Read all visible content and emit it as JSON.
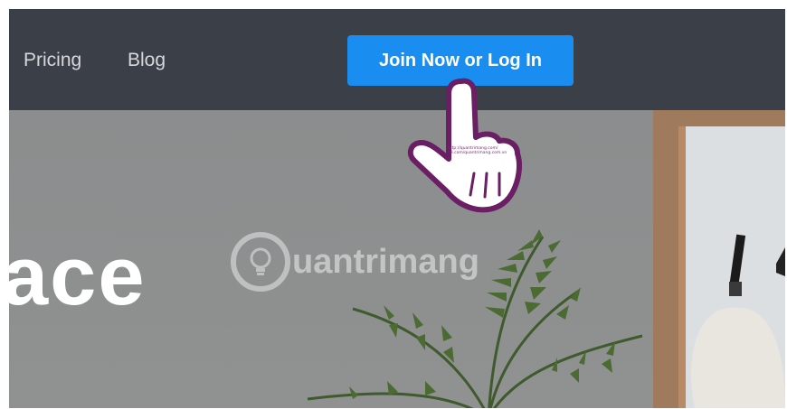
{
  "nav": {
    "links": [
      {
        "label": "Pricing"
      },
      {
        "label": "Blog"
      }
    ],
    "cta_label": "Join Now or Log In"
  },
  "hero": {
    "headline_fragment": "ace"
  },
  "watermark": {
    "text": "uantrimang"
  },
  "cursor": {
    "icon": "hand-pointer-icon",
    "caption_line1": "http://quantrimang.com/",
    "caption_line2": "FB.com/quantrimang.com.vn"
  },
  "colors": {
    "nav_bg": "#3b3f48",
    "cta_bg": "#1a8ef0",
    "cursor_outline": "#6a1e63"
  }
}
